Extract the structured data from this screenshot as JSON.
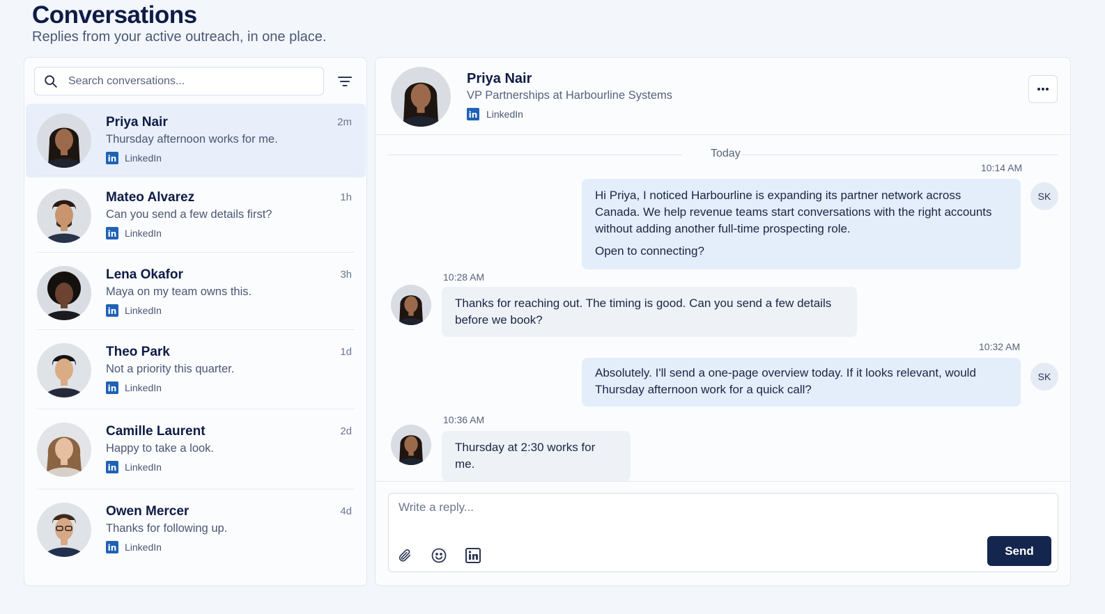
{
  "page": {
    "title": "Conversations",
    "subtitle": "Replies from your active outreach, in one place."
  },
  "search": {
    "placeholder": "Search conversations..."
  },
  "conversations": [
    {
      "name": "Priya Nair",
      "time": "2m",
      "preview": "Thursday afternoon works for me.",
      "source": "LinkedIn",
      "active": true
    },
    {
      "name": "Mateo Alvarez",
      "time": "1h",
      "preview": "Can you send a few details first?",
      "source": "LinkedIn"
    },
    {
      "name": "Lena Okafor",
      "time": "3h",
      "preview": "Maya on my team owns this.",
      "source": "LinkedIn"
    },
    {
      "name": "Theo Park",
      "time": "1d",
      "preview": "Not a priority this quarter.",
      "source": "LinkedIn"
    },
    {
      "name": "Camille Laurent",
      "time": "2d",
      "preview": "Happy to take a look.",
      "source": "LinkedIn"
    },
    {
      "name": "Owen Mercer",
      "time": "4d",
      "preview": "Thanks for following up.",
      "source": "LinkedIn"
    }
  ],
  "chat": {
    "contact": {
      "name": "Priya Nair",
      "title": "VP Partnerships at Harbourline Systems",
      "source": "LinkedIn"
    },
    "day_label": "Today",
    "messages": [
      {
        "direction": "out",
        "time": "10:14 AM",
        "sender_initials": "SK",
        "paragraphs": [
          "Hi Priya, I noticed Harbourline is expanding its partner network across Canada. We help revenue teams start conversations with the right accounts without adding another full-time prospecting role.",
          "Open to connecting?"
        ]
      },
      {
        "direction": "in",
        "time": "10:28 AM",
        "paragraphs": [
          "Thanks for reaching out. The timing is good. Can you send a few details before we book?"
        ]
      },
      {
        "direction": "out",
        "time": "10:32 AM",
        "sender_initials": "SK",
        "paragraphs": [
          "Absolutely. I'll send a one-page overview today. If it looks relevant, would Thursday afternoon work for a quick call?"
        ]
      },
      {
        "direction": "in",
        "time": "10:36 AM",
        "paragraphs": [
          "Thursday at 2:30 works for me."
        ]
      }
    ],
    "composer": {
      "placeholder": "Write a reply...",
      "send_label": "Send"
    }
  },
  "colors": {
    "accent": "#14264d",
    "linkedin": "#1f62b5",
    "active_row": "#e8effa",
    "outgoing_bubble": "#e4edfa",
    "incoming_bubble": "#eef1f6"
  },
  "icons": [
    "search-icon",
    "filter-icon",
    "linkedin-icon",
    "more-icon",
    "attachment-icon",
    "emoji-icon"
  ]
}
